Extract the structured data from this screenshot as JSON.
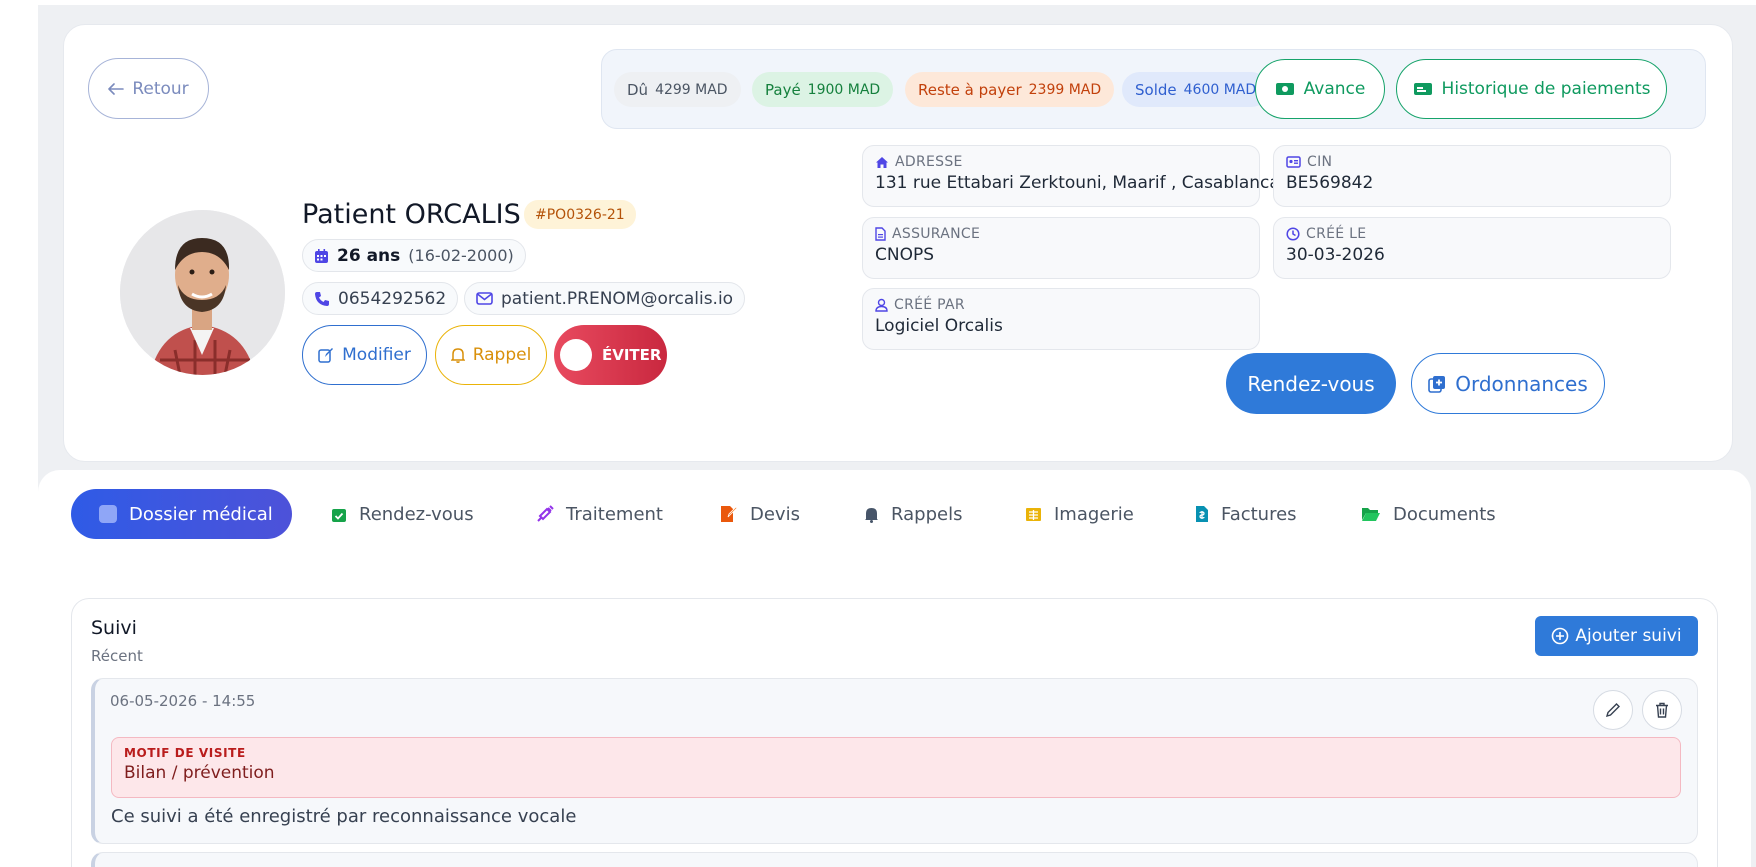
{
  "header": {
    "back_label": "Retour",
    "patient_name": "Patient ORCALIS",
    "patient_code": "#PO0326-21",
    "age": "26 ans",
    "dob": "(16-02-2000)",
    "phone": "0654292562",
    "email": "patient.PRENOM@orcalis.io",
    "modifier_label": "Modifier",
    "rappel_label": "Rappel",
    "eviter_label": "ÉVITER"
  },
  "summary": {
    "du_label": "Dû",
    "du_value": "4299 MAD",
    "paye_label": "Payé",
    "paye_value": "1900 MAD",
    "reste_label": "Reste à payer",
    "reste_value": "2399 MAD",
    "solde_label": "Solde",
    "solde_value": "4600 MAD",
    "avance_label": "Avance",
    "historique_label": "Historique de paiements"
  },
  "info": {
    "adresse_label": "ADRESSE",
    "adresse_value": "131 rue Ettabari Zerktouni, Maarif , Casablanca",
    "cin_label": "CIN",
    "cin_value": "BE569842",
    "assurance_label": "ASSURANCE",
    "assurance_value": "CNOPS",
    "cree_le_label": "CRÉÉ LE",
    "cree_le_value": "30-03-2026",
    "cree_par_label": "CRÉÉ PAR",
    "cree_par_value": "Logiciel Orcalis"
  },
  "actions": {
    "rdv_label": "Rendez-vous",
    "ordonnances_label": "Ordonnances"
  },
  "tabs": [
    {
      "label": "Dossier médical",
      "icon": "folder-plus-icon",
      "active": true
    },
    {
      "label": "Rendez-vous",
      "icon": "calendar-check-icon",
      "color": "#16a34a"
    },
    {
      "label": "Traitement",
      "icon": "syringe-icon",
      "color": "#9333ea"
    },
    {
      "label": "Devis",
      "icon": "file-edit-icon",
      "color": "#ea580c"
    },
    {
      "label": "Rappels",
      "icon": "bell-icon",
      "color": "#475569"
    },
    {
      "label": "Imagerie",
      "icon": "xray-icon",
      "color": "#eab308"
    },
    {
      "label": "Factures",
      "icon": "invoice-icon",
      "color": "#0891b2"
    },
    {
      "label": "Documents",
      "icon": "folder-open-icon",
      "color": "#16a34a"
    }
  ],
  "suivi": {
    "title": "Suivi",
    "subtitle": "Récent",
    "add_label": "Ajouter suivi",
    "entries": [
      {
        "date": "06-05-2026 - 14:55",
        "motif_label": "MOTIF DE VISITE",
        "motif_value": "Bilan / prévention",
        "text": "Ce suivi a été enregistré par reconnaissance vocale"
      }
    ]
  },
  "colors": {
    "primary": "#2f7ad9",
    "success": "#16a36a",
    "danger": "#e84a5f",
    "warning": "#eab308"
  }
}
